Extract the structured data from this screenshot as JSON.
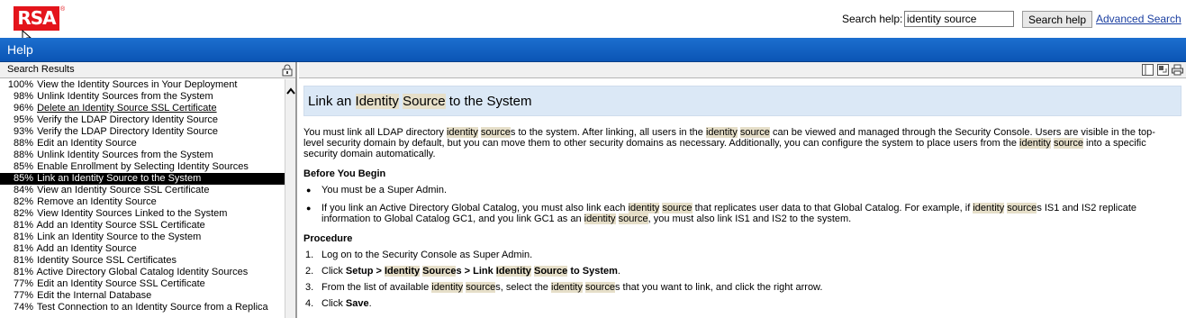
{
  "header": {
    "logo_text": "RSA",
    "logo_reg": "®",
    "search_label": "Search help:",
    "search_value": "identity source",
    "search_button": "Search help",
    "advanced_link": "Advanced Search"
  },
  "helpbar": {
    "title": "Help"
  },
  "left": {
    "header_label": "Search Results",
    "results": [
      {
        "pct": "100%",
        "title": "View the Identity Sources in Your Deployment"
      },
      {
        "pct": "98%",
        "title": "Unlink Identity Sources from the System"
      },
      {
        "pct": "96%",
        "title": "Delete an Identity Source SSL Certificate"
      },
      {
        "pct": "95%",
        "title": "Verify the LDAP Directory Identity Source"
      },
      {
        "pct": "93%",
        "title": "Verify the LDAP Directory Identity Source"
      },
      {
        "pct": "88%",
        "title": "Edit an Identity Source"
      },
      {
        "pct": "88%",
        "title": "Unlink Identity Sources from the System"
      },
      {
        "pct": "85%",
        "title": "Enable Enrollment by Selecting Identity Sources"
      },
      {
        "pct": "85%",
        "title": "Link an Identity Source to the System"
      },
      {
        "pct": "84%",
        "title": "View an Identity Source SSL Certificate"
      },
      {
        "pct": "82%",
        "title": "Remove an Identity Source"
      },
      {
        "pct": "82%",
        "title": "View Identity Sources Linked to the System"
      },
      {
        "pct": "81%",
        "title": "Add an Identity Source SSL Certificate"
      },
      {
        "pct": "81%",
        "title": "Link an Identity Source to the System"
      },
      {
        "pct": "81%",
        "title": "Add an Identity Source"
      },
      {
        "pct": "81%",
        "title": "Identity Source SSL Certificates"
      },
      {
        "pct": "81%",
        "title": "Active Directory Global Catalog Identity Sources"
      },
      {
        "pct": "77%",
        "title": "Edit an Identity Source SSL Certificate"
      },
      {
        "pct": "77%",
        "title": "Edit the Internal Database"
      },
      {
        "pct": "74%",
        "title": "Test Connection to an Identity Source from a Replica"
      }
    ],
    "selected_index": 8,
    "underlined_index": 2
  },
  "article": {
    "title_pre": "Link an ",
    "title_hl1": "Identity",
    "title_sp": " ",
    "title_hl2": "Source",
    "title_post": " to the System",
    "intro": {
      "a": "You must link all LDAP directory ",
      "h1": "identity",
      "b": " ",
      "h2": "source",
      "c": "s to the system. After linking, all users in the ",
      "h3": "identity",
      "d": " ",
      "h4": "source",
      "e": " can be viewed and managed through the Security Console. Users are visible in the top-level security domain by default, but you can move them to other security domains as necessary. Additionally, you can configure the system to place users from the ",
      "h5": "identity",
      "f": " ",
      "h6": "source",
      "g": " into a specific security domain automatically."
    },
    "before_heading": "Before You Begin",
    "bullet1": "You must be a Super Admin.",
    "bullet2": {
      "a": "If you link an Active Directory Global Catalog, you must also link each ",
      "h1": "identity",
      "b": " ",
      "h2": "source",
      "c": " that replicates user data to that Global Catalog. For example, if ",
      "h3": "identity",
      "d": " ",
      "h4": "source",
      "e": "s IS1 and IS2 replicate information to Global Catalog GC1, and you link GC1 as an ",
      "h5": "identity",
      "f": " ",
      "h6": "source",
      "g": ", you must also link IS1 and IS2 to the system."
    },
    "procedure_heading": "Procedure",
    "steps": {
      "s1": "Log on to the Security Console as Super Admin.",
      "s2": {
        "a": "Click ",
        "b1": "Setup > ",
        "h1": "Identity",
        "sp1": " ",
        "h2": "Source",
        "b2": "s > Link ",
        "h3": "Identity",
        "sp2": " ",
        "h4": "Source",
        "b3": " to System",
        "end": "."
      },
      "s3": {
        "a": "From the list of available ",
        "h1": "identity",
        "b": " ",
        "h2": "source",
        "c": "s, select the ",
        "h3": "identity",
        "d": " ",
        "h4": "source",
        "e": "s that you want to link, and click the right arrow."
      },
      "s4": {
        "a": "Click ",
        "b": "Save",
        "end": "."
      },
      "nums": [
        "1.",
        "2.",
        "3.",
        "4."
      ]
    }
  },
  "colors": {
    "brand_red": "#e4141b",
    "help_bar_blue": "#0b55b5",
    "title_bg": "#dbe8f6",
    "highlight": "#e6dfc9",
    "link": "#1a3ea0"
  },
  "icons": [
    "rsa-logo",
    "mouse-cursor-icon",
    "lock-icon",
    "scroll-up-arrow-icon",
    "toc-icon",
    "sync-icon",
    "print-icon"
  ]
}
